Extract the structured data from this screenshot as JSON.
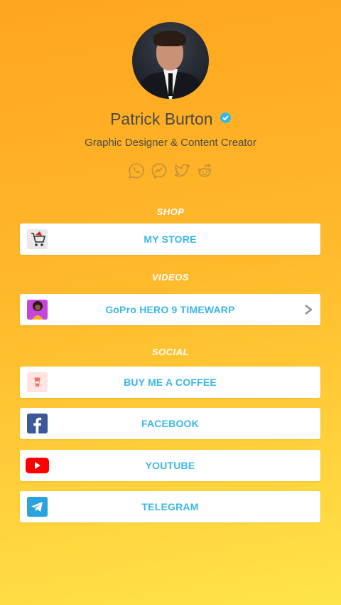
{
  "profile": {
    "name": "Patrick Burton",
    "subtitle": "Graphic Designer & Content Creator",
    "social_icons": [
      "whatsapp-icon",
      "messenger-icon",
      "twitter-icon",
      "reddit-icon"
    ]
  },
  "sections": {
    "shop": "SHOP",
    "videos": "VIDEOS",
    "social": "SOCIAL"
  },
  "links": {
    "my_store": "MY STORE",
    "gopro": "GoPro HERO 9 TIMEWARP",
    "coffee": "BUY ME A COFFEE",
    "facebook": "FACEBOOK",
    "youtube": "YOUTUBE",
    "telegram": "TELEGRAM"
  },
  "colors": {
    "accent": "#39b6e8",
    "verified": "#35b6e8",
    "facebook": "#3b5998",
    "youtube": "#ff0000",
    "telegram": "#2aa3dc"
  }
}
